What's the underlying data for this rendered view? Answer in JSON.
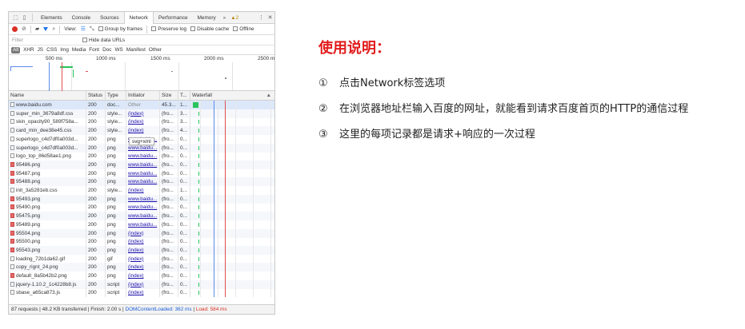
{
  "devtools": {
    "tabs": [
      "Elements",
      "Console",
      "Sources",
      "Network",
      "Performance",
      "Memory"
    ],
    "active_tab": "Network",
    "more_tabs": "»",
    "warning_count": "2",
    "toolbar": {
      "view_label": "View:",
      "group_by_frames": "Group by frames",
      "preserve_log": "Preserve log",
      "disable_cache": "Disable cache",
      "offline": "Offline"
    },
    "filter": {
      "placeholder": "Filter",
      "hide_data_urls": "Hide data URLs"
    },
    "types": [
      "All",
      "XHR",
      "JS",
      "CSS",
      "Img",
      "Media",
      "Font",
      "Doc",
      "WS",
      "Manifest",
      "Other"
    ],
    "overview_ticks": [
      "500 ms",
      "1000 ms",
      "1500 ms",
      "2000 ms",
      "2500 m"
    ],
    "columns": [
      "Name",
      "Status",
      "Type",
      "Initiator",
      "Size",
      "T...",
      "Waterfall"
    ],
    "tooltip": "svg+xml",
    "requests": [
      {
        "name": "www.baidu.com",
        "status": "200",
        "type": "doc...",
        "initiator": "Other",
        "size": "45.3...",
        "time": "1...",
        "icon": "document-icon"
      },
      {
        "name": "super_min_3679a8df.css",
        "status": "200",
        "type": "style...",
        "initiator": "(index)",
        "size": "(fro...",
        "time": "3...",
        "icon": "file-icon"
      },
      {
        "name": "skin_opacity90_589f758a...",
        "status": "200",
        "type": "style...",
        "initiator": "(index)",
        "size": "(fro...",
        "time": "3...",
        "icon": "file-icon"
      },
      {
        "name": "card_min_dee38e45.css",
        "status": "200",
        "type": "style...",
        "initiator": "(index)",
        "size": "(fro...",
        "time": "4...",
        "icon": "file-icon"
      },
      {
        "name": "superlogo_c4d7df0a003d...",
        "status": "200",
        "type": "png",
        "initiator": "www.baidu...",
        "size": "(fro...",
        "time": "0...",
        "icon": "file-icon"
      },
      {
        "name": "superlogo_c4d7df0a003d...",
        "status": "200",
        "type": "png",
        "initiator": "www.baidu...",
        "size": "(fro...",
        "time": "0...",
        "icon": "file-icon"
      },
      {
        "name": "logo_top_86d58ae1.png",
        "status": "200",
        "type": "png",
        "initiator": "www.baidu...",
        "size": "(fro...",
        "time": "0...",
        "icon": "file-icon"
      },
      {
        "name": "95486.png",
        "status": "200",
        "type": "png",
        "initiator": "www.baidu...",
        "size": "(fro...",
        "time": "0...",
        "icon": "image-icon"
      },
      {
        "name": "95487.png",
        "status": "200",
        "type": "png",
        "initiator": "www.baidu...",
        "size": "(fro...",
        "time": "0...",
        "icon": "image-icon"
      },
      {
        "name": "95488.png",
        "status": "200",
        "type": "png",
        "initiator": "www.baidu...",
        "size": "(fro...",
        "time": "0...",
        "icon": "image-icon"
      },
      {
        "name": "init_3a5281eb.css",
        "status": "200",
        "type": "style...",
        "initiator": "(index)",
        "size": "(fro...",
        "time": "1...",
        "icon": "file-icon"
      },
      {
        "name": "95493.png",
        "status": "200",
        "type": "png",
        "initiator": "www.baidu...",
        "size": "(fro...",
        "time": "0...",
        "icon": "image-icon"
      },
      {
        "name": "95490.png",
        "status": "200",
        "type": "png",
        "initiator": "www.baidu...",
        "size": "(fro...",
        "time": "0...",
        "icon": "image-icon"
      },
      {
        "name": "95475.png",
        "status": "200",
        "type": "png",
        "initiator": "www.baidu...",
        "size": "(fro...",
        "time": "0...",
        "icon": "image-icon"
      },
      {
        "name": "95489.png",
        "status": "200",
        "type": "png",
        "initiator": "www.baidu...",
        "size": "(fro...",
        "time": "0...",
        "icon": "image-icon"
      },
      {
        "name": "95504.png",
        "status": "200",
        "type": "png",
        "initiator": "(index)",
        "size": "(fro...",
        "time": "0...",
        "icon": "image-icon"
      },
      {
        "name": "95500.png",
        "status": "200",
        "type": "png",
        "initiator": "(index)",
        "size": "(fro...",
        "time": "0...",
        "icon": "image-icon"
      },
      {
        "name": "95543.png",
        "status": "200",
        "type": "png",
        "initiator": "(index)",
        "size": "(fro...",
        "time": "0...",
        "icon": "image-icon"
      },
      {
        "name": "loading_72b1da62.gif",
        "status": "200",
        "type": "gif",
        "initiator": "(index)",
        "size": "(fro...",
        "time": "0...",
        "icon": "file-icon"
      },
      {
        "name": "copy_rignt_24.png",
        "status": "200",
        "type": "png",
        "initiator": "(index)",
        "size": "(fro...",
        "time": "0...",
        "icon": "file-icon"
      },
      {
        "name": "default_8a5b42b2.png",
        "status": "200",
        "type": "png",
        "initiator": "(index)",
        "size": "(fro...",
        "time": "0...",
        "icon": "image-icon"
      },
      {
        "name": "jquery-1.10.2_1c4228b8.js",
        "status": "200",
        "type": "script",
        "initiator": "(index)",
        "size": "(fro...",
        "time": "0...",
        "icon": "file-icon"
      },
      {
        "name": "sbase_a65ca873.js",
        "status": "200",
        "type": "script",
        "initiator": "(index)",
        "size": "(fro...",
        "time": "0...",
        "icon": "file-icon"
      }
    ],
    "status": {
      "summary": "87 requests | 48.2 KB transferred | Finish: 2.00 s | ",
      "dom_content_loaded": "DOMContentLoaded: 362 ms",
      "separator": " | ",
      "load": "Load: 584 ms"
    },
    "colors": {
      "dcl_line": "#5b8be8",
      "load_line": "#e05050",
      "waterfall_bar": "#29c45b",
      "selected_row": "#dce8fa"
    }
  },
  "instructions": {
    "title": "使用说明：",
    "steps": [
      {
        "num": "①",
        "text": "点击Network标签选项"
      },
      {
        "num": "②",
        "text": "在浏览器地址栏输入百度的网址，就能看到请求百度首页的HTTP的通信过程"
      },
      {
        "num": "③",
        "text": "这里的每项记录都是请求+响应的一次过程"
      }
    ],
    "title_color": "#e21c1c"
  }
}
